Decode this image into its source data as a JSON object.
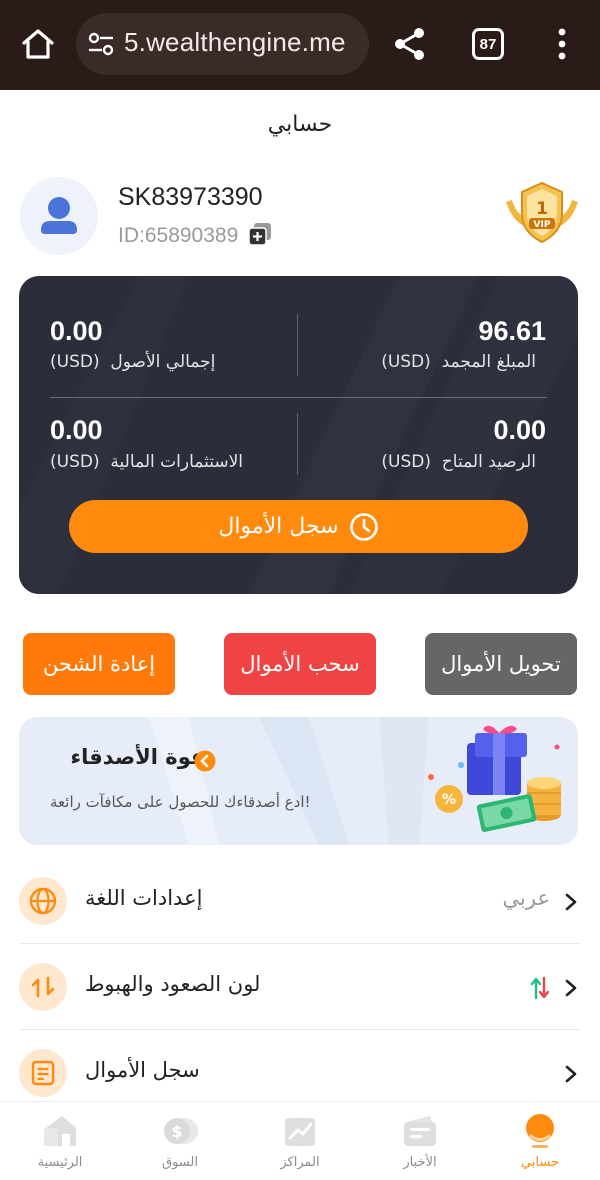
{
  "browser": {
    "url": "5.wealthengine.me",
    "tab_count": "87"
  },
  "header": {
    "title": "حسابي"
  },
  "profile": {
    "username": "SK83973390",
    "id_text": "ID:65890389",
    "vip_badge_text": "1",
    "vip_label": "VIP"
  },
  "balance": {
    "frozen_amount": {
      "value": "96.61",
      "label": "المبلغ المجمد",
      "unit": "(USD)"
    },
    "total_assets": {
      "value": "0.00",
      "label": "إجمالي الأصول",
      "unit": "(USD)"
    },
    "available_balance": {
      "value": "0.00",
      "label": "الرصيد المتاح",
      "unit": "(USD)"
    },
    "investments": {
      "value": "0.00",
      "label": "الاستثمارات المالية",
      "unit": "(USD)"
    },
    "funds_log_button": "سجل الأموال"
  },
  "actions": {
    "transfer": "تحويل الأموال",
    "withdraw": "سحب الأموال",
    "recharge": "إعادة الشحن"
  },
  "invite": {
    "title": "دعوة الأصدقاء",
    "subtitle": "ادع أصدقاءك للحصول على مكافآت رائعة!"
  },
  "settings": [
    {
      "label": "إعدادات اللغة",
      "value": "عربي",
      "icon": "globe-icon"
    },
    {
      "label": "لون الصعود والهبوط",
      "value": "",
      "icon": "swap-arrows-icon"
    },
    {
      "label": "سجل الأموال",
      "value": "",
      "icon": "document-icon"
    }
  ],
  "nav": [
    {
      "label": "حسابي",
      "icon": "profile-icon",
      "active": true
    },
    {
      "label": "الأخبار",
      "icon": "news-icon",
      "active": false
    },
    {
      "label": "المراكز",
      "icon": "positions-icon",
      "active": false
    },
    {
      "label": "السوق",
      "icon": "market-icon",
      "active": false
    },
    {
      "label": "الرئيسية",
      "icon": "home-icon",
      "active": false
    }
  ],
  "colors": {
    "accent_orange": "#ff8a0d",
    "withdraw_red": "#f04343",
    "transfer_gray": "#666666",
    "card_dark": "#2b2e3a",
    "browser_bar": "#2a1b18",
    "up_green": "#1bbf8a",
    "down_red": "#f04343"
  }
}
